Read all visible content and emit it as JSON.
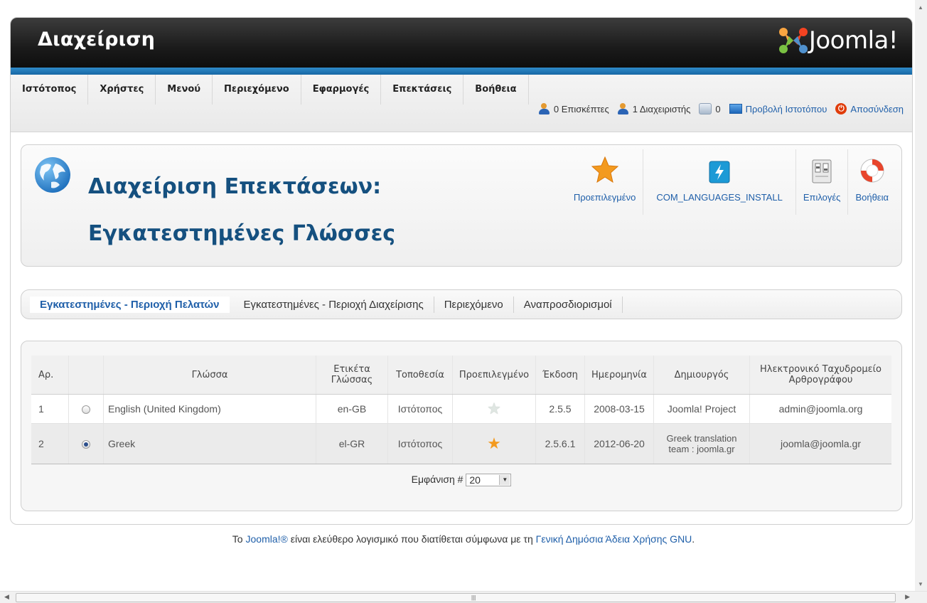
{
  "header": {
    "title": "Διαχείριση",
    "brand": "Joomla!"
  },
  "menu": [
    {
      "label": "Ιστότοπος"
    },
    {
      "label": "Χρήστες"
    },
    {
      "label": "Μενού"
    },
    {
      "label": "Περιεχόμενο"
    },
    {
      "label": "Εφαρμογές"
    },
    {
      "label": "Επεκτάσεις"
    },
    {
      "label": "Βοήθεια"
    }
  ],
  "status": {
    "visitors": "0 Επισκέπτες",
    "admins": "1 Διαχειριστής",
    "messages": "0",
    "view_site": "Προβολή Ιστοτόπου",
    "logout": "Αποσύνδεση"
  },
  "page": {
    "title": "Διαχείριση Επεκτάσεων: Εγκατεστημένες Γλώσσες"
  },
  "toolbar": {
    "default": "Προεπιλεγμένο",
    "install": "COM_LANGUAGES_INSTALL",
    "options": "Επιλογές",
    "help": "Βοήθεια"
  },
  "subnav": [
    {
      "label": "Εγκατεστημένες - Περιοχή Πελατών",
      "active": true
    },
    {
      "label": "Εγκατεστημένες - Περιοχή Διαχείρισης"
    },
    {
      "label": "Περιεχόμενο"
    },
    {
      "label": "Αναπροσδιορισμοί"
    }
  ],
  "table": {
    "headers": {
      "num": "Αρ.",
      "language": "Γλώσσα",
      "tag": "Ετικέτα Γλώσσας",
      "location": "Τοποθεσία",
      "default": "Προεπιλεγμένο",
      "version": "Έκδοση",
      "date": "Ημερομηνία",
      "author": "Δημιουργός",
      "email": "Ηλεκτρονικό Ταχυδρομείο Αρθρογράφου"
    },
    "rows": [
      {
        "num": "1",
        "language": "English (United Kingdom)",
        "tag": "en-GB",
        "location": "Ιστότοπος",
        "is_default": false,
        "version": "2.5.5",
        "date": "2008-03-15",
        "author": "Joomla! Project",
        "email": "admin@joomla.org",
        "selected": false
      },
      {
        "num": "2",
        "language": "Greek",
        "tag": "el-GR",
        "location": "Ιστότοπος",
        "is_default": true,
        "version": "2.5.6.1",
        "date": "2012-06-20",
        "author": "Greek translation team : joomla.gr",
        "email": "joomla@joomla.gr",
        "selected": true
      }
    ]
  },
  "pager": {
    "label": "Εμφάνιση #",
    "value": "20"
  },
  "footer": {
    "prefix": "Το",
    "joomla_link": "Joomla!®",
    "middle": "είναι ελεύθερο λογισμικό που διατίθεται σύμφωνα με τη",
    "license_link": "Γενική Δημόσια Άδεια Χρήσης GNU",
    "suffix": "."
  },
  "colors": {
    "accent": "#1f5fa9",
    "header_bg": "#1b1b1b",
    "stripe": "#1e74b5",
    "title": "#15507f",
    "star": "#f39a1f"
  }
}
